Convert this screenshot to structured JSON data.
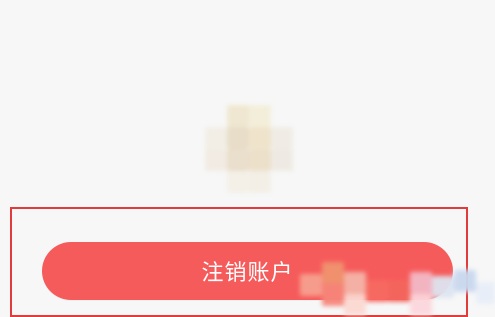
{
  "account": {
    "cancel_button_label": "注销账户"
  },
  "icons": {
    "avatar": "pixelated-avatar-icon",
    "watermark": "pixelated-watermark-icon"
  },
  "colors": {
    "background": "#f7f7f7",
    "button": "#f65b5b",
    "highlight": "#e23b3b",
    "button_text": "#ffffff"
  }
}
